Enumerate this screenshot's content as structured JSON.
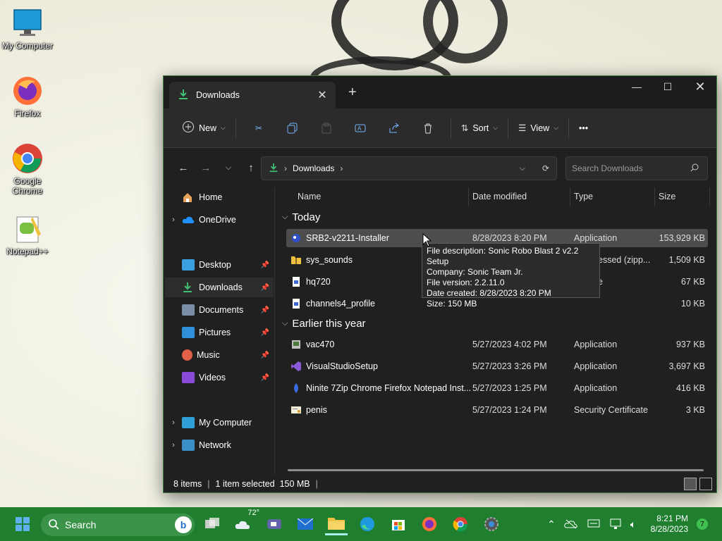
{
  "desktop": {
    "icons": [
      {
        "label": "My Computer"
      },
      {
        "label": "Firefox"
      },
      {
        "label": "Google Chrome"
      },
      {
        "label": "Notepad++"
      }
    ]
  },
  "window": {
    "tab_title": "Downloads",
    "toolbar": {
      "new_label": "New",
      "sort_label": "Sort",
      "view_label": "View",
      "more_label": "•••"
    },
    "address": {
      "crumb": "Downloads",
      "search_placeholder": "Search Downloads"
    },
    "sidebar": {
      "home": "Home",
      "onedrive": "OneDrive",
      "desktop": "Desktop",
      "downloads": "Downloads",
      "documents": "Documents",
      "pictures": "Pictures",
      "music": "Music",
      "videos": "Videos",
      "my_computer": "My Computer",
      "network": "Network"
    },
    "columns": {
      "name": "Name",
      "date": "Date modified",
      "type": "Type",
      "size": "Size"
    },
    "groups": {
      "today": "Today",
      "earlier": "Earlier this year"
    },
    "files": [
      {
        "name": "SRB2-v2211-Installer",
        "date": "8/28/2023 8:20 PM",
        "type": "Application",
        "size": "153,929 KB"
      },
      {
        "name": "sys_sounds",
        "date": "",
        "type": "essed (zipp...",
        "size": "1,509 KB"
      },
      {
        "name": "hq720",
        "date": "",
        "type": "e",
        "size": "67 KB"
      },
      {
        "name": "channels4_profile",
        "date": "",
        "type": "",
        "size": "10 KB"
      },
      {
        "name": "vac470",
        "date": "5/27/2023 4:02 PM",
        "type": "Application",
        "size": "937 KB"
      },
      {
        "name": "VisualStudioSetup",
        "date": "5/27/2023 3:26 PM",
        "type": "Application",
        "size": "3,697 KB"
      },
      {
        "name": "Ninite 7Zip Chrome Firefox Notepad Inst...",
        "date": "5/27/2023 1:25 PM",
        "type": "Application",
        "size": "416 KB"
      },
      {
        "name": "penis",
        "date": "5/27/2023 1:24 PM",
        "type": "Security Certificate",
        "size": "3 KB"
      }
    ],
    "tooltip": {
      "line1": "File description: Sonic Robo Blast 2 v2.2 Setup",
      "line2": "Company: Sonic Team Jr.",
      "line3": "File version: 2.2.11.0",
      "line4": "Date created: 8/28/2023 8:20 PM",
      "line5": "Size: 150 MB"
    },
    "status": {
      "items": "8 items",
      "selected": "1 item selected  150 MB"
    }
  },
  "taskbar": {
    "search_label": "Search",
    "weather_temp": "72°",
    "time": "8:21 PM",
    "date": "8/28/2023",
    "notifications": "7"
  }
}
